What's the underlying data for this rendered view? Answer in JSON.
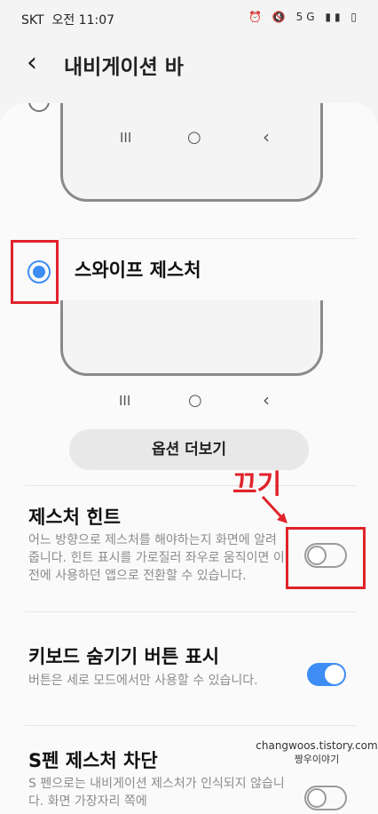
{
  "status_bar": {
    "carrier": "SKT",
    "time": "오전 11:07",
    "indicators": "⏰ 🔇 5G ▮▮ ▯"
  },
  "app_bar": {
    "back_icon": "‹",
    "title": "내비게이션 바"
  },
  "nav_buttons": {
    "recent": "III",
    "home": "○",
    "back": "‹"
  },
  "options": {
    "swipe_gesture_label": "스와이프 제스처"
  },
  "more_options_label": "옵션 더보기",
  "annotation": {
    "text": "끄기",
    "color": "#e0232a"
  },
  "settings": [
    {
      "title": "제스처 힌트",
      "desc": "어느 방향으로 제스처를 해야하는지 화면에 알려줍니다. 힌트 표시를 가로질러 좌우로 움직이면 이전에 사용하던 앱으로 전환할 수 있습니다.",
      "enabled": false
    },
    {
      "title": "키보드 숨기기 버튼 표시",
      "desc": "버튼은 세로 모드에서만 사용할 수 있습니다.",
      "enabled": true
    },
    {
      "title": "S펜 제스처 차단",
      "desc": "S 펜으로는 내비게이션 제스처가 인식되지 않습니다. 화면 가장자리 쪽에",
      "enabled": false
    }
  ],
  "watermark": {
    "site": "changwoos.tistory.com",
    "name": "짱우이야기"
  },
  "colors": {
    "accent": "#3d8df5",
    "highlight": "#e0232a"
  }
}
